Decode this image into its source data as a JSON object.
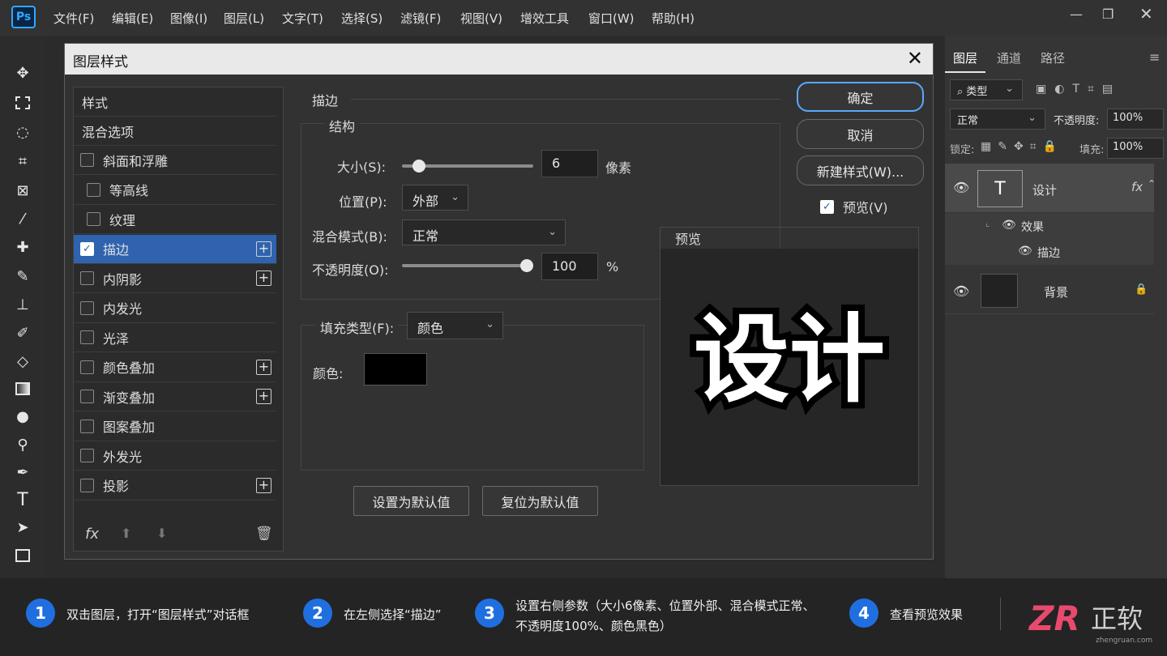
{
  "app": {
    "logo": "Ps",
    "menu": [
      "文件(F)",
      "编辑(E)",
      "图像(I)",
      "图层(L)",
      "文字(T)",
      "选择(S)",
      "滤镜(F)",
      "视图(V)",
      "增效工具",
      "窗口(W)",
      "帮助(H)"
    ]
  },
  "dialog": {
    "title": "图层样式",
    "styles_header": "样式",
    "blend_options": "混合选项",
    "effects": [
      {
        "label": "斜面和浮雕",
        "checked": false,
        "plus": false
      },
      {
        "label": "等高线",
        "checked": false,
        "plus": false
      },
      {
        "label": "纹理",
        "checked": false,
        "plus": false
      },
      {
        "label": "描边",
        "checked": true,
        "plus": true
      },
      {
        "label": "内阴影",
        "checked": false,
        "plus": true
      },
      {
        "label": "内发光",
        "checked": false,
        "plus": false
      },
      {
        "label": "光泽",
        "checked": false,
        "plus": false
      },
      {
        "label": "颜色叠加",
        "checked": false,
        "plus": true
      },
      {
        "label": "渐变叠加",
        "checked": false,
        "plus": true
      },
      {
        "label": "图案叠加",
        "checked": false,
        "plus": false
      },
      {
        "label": "外发光",
        "checked": false,
        "plus": false
      },
      {
        "label": "投影",
        "checked": false,
        "plus": true
      }
    ],
    "fx_label": "fx",
    "stroke": {
      "section_title": "描边",
      "structure_title": "结构",
      "size_label": "大小(S):",
      "size_value": "6",
      "size_unit": "像素",
      "size_fraction": 0.05,
      "position_label": "位置(P):",
      "position_value": "外部",
      "blend_label": "混合模式(B):",
      "blend_value": "正常",
      "opacity_label": "不透明度(O):",
      "opacity_value": "100",
      "opacity_unit": "%",
      "opacity_fraction": 1.0,
      "fill_type_label": "填充类型(F):",
      "fill_type_value": "颜色",
      "color_label": "颜色:",
      "color_value": "#000000"
    },
    "buttons": {
      "ok": "确定",
      "cancel": "取消",
      "new_style": "新建样式(W)...",
      "preview_label": "预览(V)",
      "set_default": "设置为默认值",
      "reset_default": "复位为默认值"
    },
    "preview": {
      "title": "预览",
      "sample_text": "设计"
    }
  },
  "layers_panel": {
    "tabs": [
      "图层",
      "通道",
      "路径"
    ],
    "filter_label": "类型",
    "blend_mode": "正常",
    "opacity_label": "不透明度:",
    "opacity_value": "100%",
    "lock_label": "锁定:",
    "fill_label": "填充:",
    "fill_value": "100%",
    "layers": {
      "text_layer": "设计",
      "fx": "fx",
      "effects_label": "效果",
      "stroke_effect": "描边",
      "background": "背景"
    }
  },
  "steps": [
    {
      "num": "1",
      "text": "双击图层，打开“图层样式”对话框"
    },
    {
      "num": "2",
      "text": "在左侧选择“描边”"
    },
    {
      "num": "3",
      "text": "设置右侧参数（大小6像素、位置外部、混合模式正常、",
      "text2": "不透明度100%、颜色黑色）"
    },
    {
      "num": "4",
      "text": "查看预览效果"
    }
  ],
  "brand": {
    "logo_text": "正软",
    "logo_letters": "ZR",
    "url": "zhengruan.com"
  },
  "colors": {
    "accent": "#2f63b0",
    "step_badge": "#1f6fe0",
    "ps_blue": "#31a8ff"
  }
}
